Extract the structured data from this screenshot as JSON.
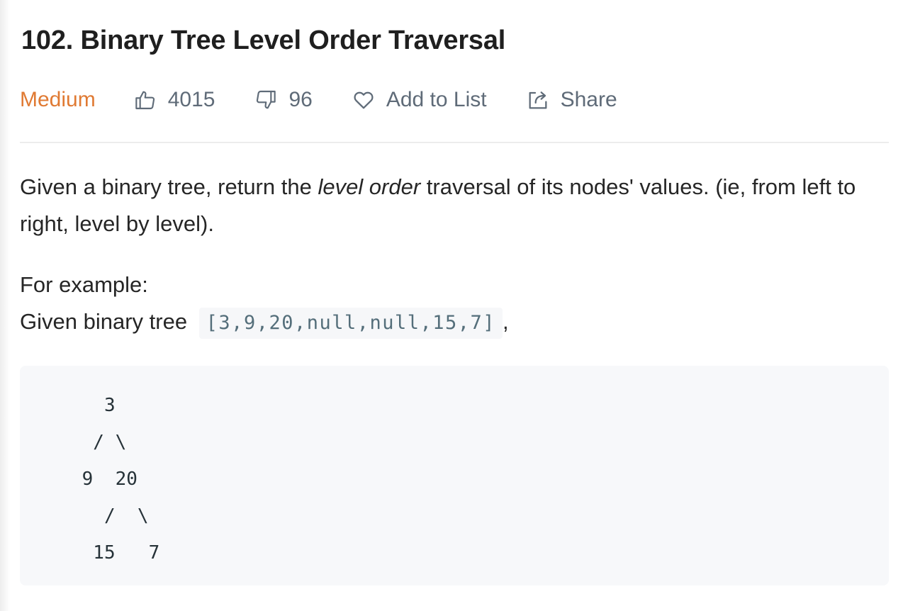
{
  "problem": {
    "title": "102. Binary Tree Level Order Traversal",
    "difficulty": "Medium",
    "likes": "4015",
    "dislikes": "96",
    "add_to_list_label": "Add to List",
    "share_label": "Share"
  },
  "description": {
    "part1": "Given a binary tree, return the ",
    "emphasis": "level order",
    "part2": " traversal of its nodes' values. (ie, from left to right, level by level)."
  },
  "example": {
    "heading": "For example:",
    "intro": "Given binary tree ",
    "input": "[3,9,20,null,null,15,7]",
    "suffix": ",",
    "tree": "   3\n  / \\\n 9  20\n   /  \\\n  15   7"
  },
  "colors": {
    "difficulty": "#e07a33",
    "meta_text": "#5f6b78",
    "code_bg": "#f7f8fa"
  },
  "icons": {
    "like": "thumbs-up-icon",
    "dislike": "thumbs-down-icon",
    "favorite": "heart-icon",
    "share": "share-icon"
  }
}
